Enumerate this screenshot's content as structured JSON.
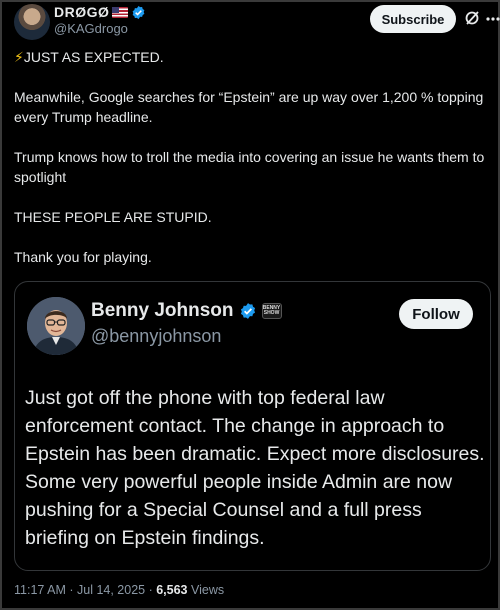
{
  "post": {
    "author_name": "DRØGØ",
    "author_handle": "@KAGdrogo",
    "subscribe_label": "Subscribe",
    "bolt": "⚡",
    "paragraphs": [
      "JUST AS EXPECTED.",
      "Meanwhile, Google searches for “Epstein” are up way over 1,200 % topping every Trump headline.",
      "Trump knows how to troll the media into covering an issue he wants them to spotlight",
      "THESE PEOPLE ARE STUPID.",
      "Thank you for playing."
    ]
  },
  "quote": {
    "author_name": "Benny Johnson",
    "author_handle": "@bennyjohnson",
    "follow_label": "Follow",
    "affiliate_text": "BENNY SHOW",
    "text": "Just got off the phone with top federal law enforcement contact. The change in approach to Epstein has been dramatic. Expect more disclosures. Some very powerful people inside Admin are now pushing for a Special Counsel and a full press briefing on Epstein findings."
  },
  "meta": {
    "timestamp": "11:17 AM · Jul 14, 2025 · ",
    "views_count": "6,563",
    "views_label": " Views"
  },
  "colors": {
    "background": "#000000",
    "text": "#e7e9ea",
    "muted": "#8b98a5",
    "verified": "#1d9bf0",
    "button_bg": "#eff3f4"
  },
  "icons": [
    "verified-badge-icon",
    "us-flag-icon",
    "grok-icon",
    "more-icon",
    "bolt-icon"
  ]
}
